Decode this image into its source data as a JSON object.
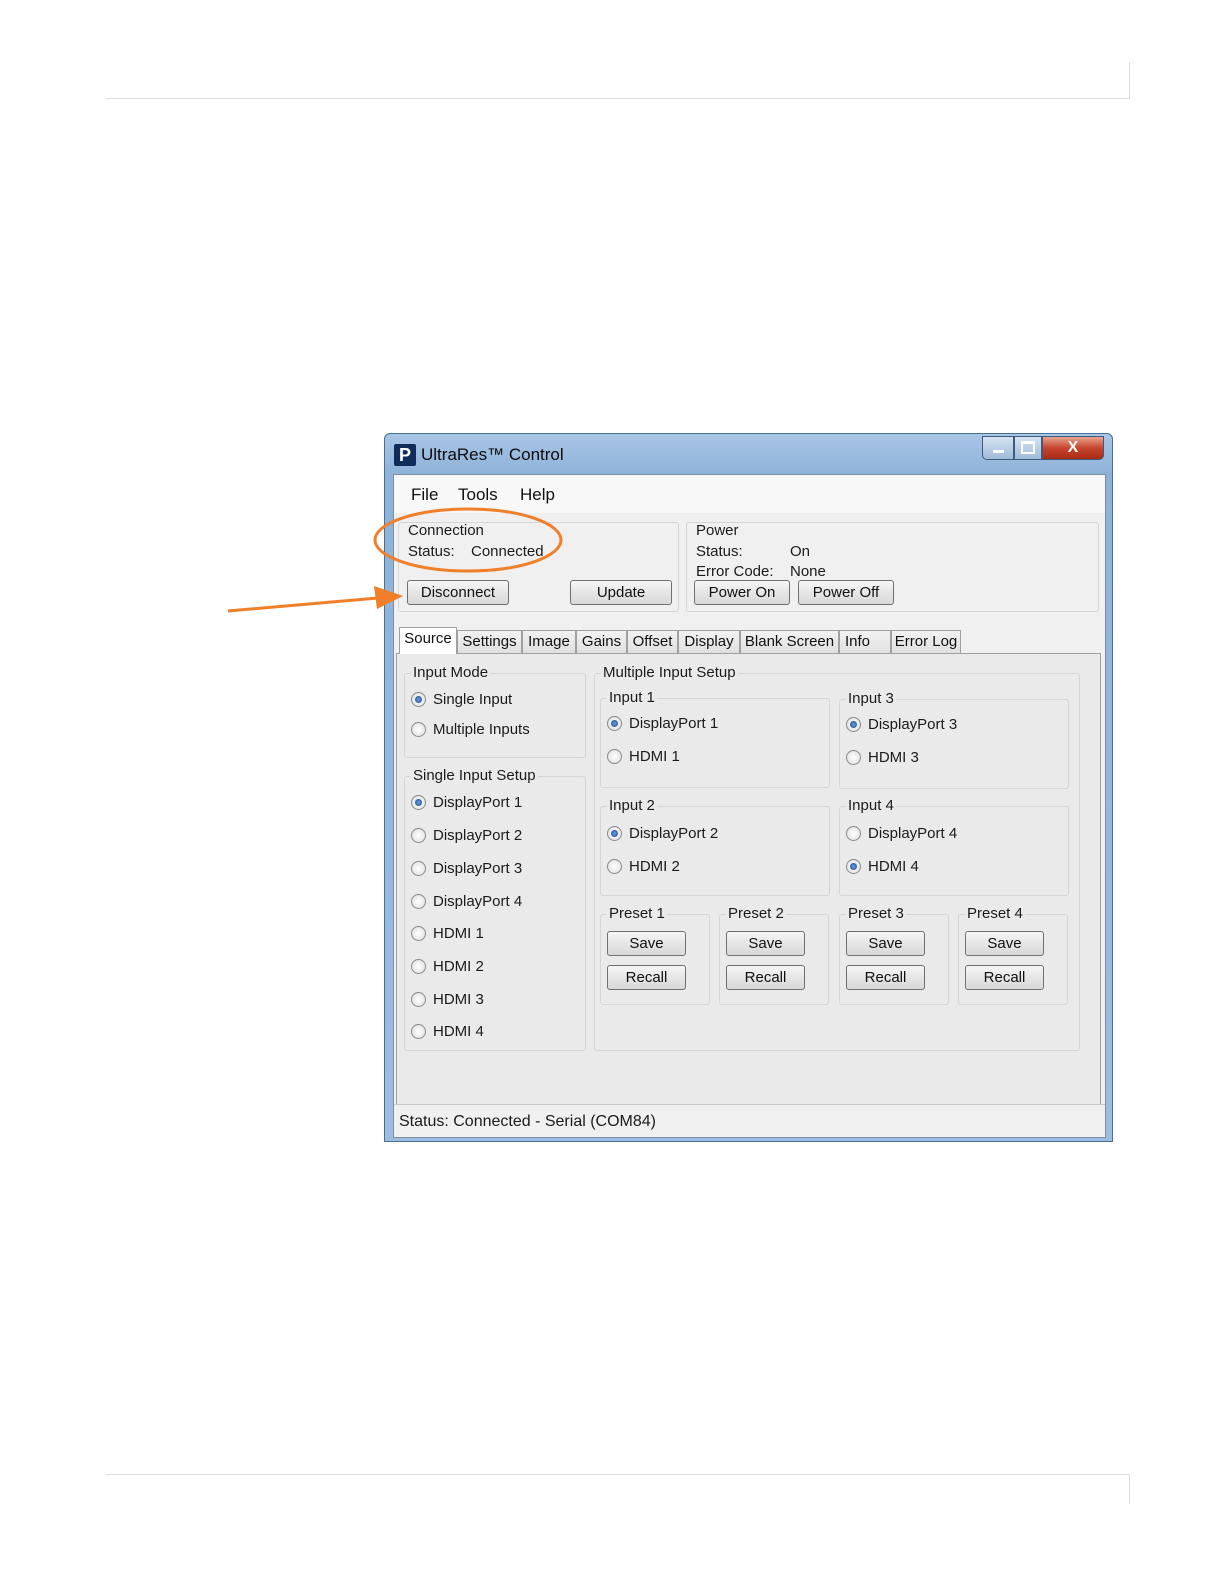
{
  "window": {
    "logo_letter": "P",
    "title": "UltraRes™ Control",
    "close_glyph": "X"
  },
  "menu": [
    "File",
    "Tools",
    "Help"
  ],
  "connection": {
    "group_label": "Connection",
    "status_label": "Status:",
    "status_value": "Connected",
    "disconnect_label": "Disconnect",
    "update_label": "Update"
  },
  "power": {
    "group_label": "Power",
    "status_label": "Status:",
    "status_value": "On",
    "error_label": "Error Code:",
    "error_value": "None",
    "power_on_label": "Power On",
    "power_off_label": "Power Off"
  },
  "tabs": [
    "Source",
    "Settings",
    "Image",
    "Gains",
    "Offset",
    "Display",
    "Blank Screen",
    "Info",
    "Error Log"
  ],
  "active_tab": "Source",
  "input_mode": {
    "label": "Input Mode",
    "options": [
      "Single Input",
      "Multiple Inputs"
    ],
    "selected": "Single Input"
  },
  "single_input_setup": {
    "label": "Single Input Setup",
    "options": [
      "DisplayPort 1",
      "DisplayPort 2",
      "DisplayPort 3",
      "DisplayPort 4",
      "HDMI 1",
      "HDMI 2",
      "HDMI 3",
      "HDMI 4"
    ],
    "selected": "DisplayPort 1"
  },
  "multiple_input_setup": {
    "label": "Multiple Input Setup",
    "inputs": [
      {
        "label": "Input 1",
        "options": [
          "DisplayPort 1",
          "HDMI 1"
        ],
        "selected": "DisplayPort 1"
      },
      {
        "label": "Input 3",
        "options": [
          "DisplayPort 3",
          "HDMI 3"
        ],
        "selected": "DisplayPort 3"
      },
      {
        "label": "Input 2",
        "options": [
          "DisplayPort 2",
          "HDMI 2"
        ],
        "selected": "DisplayPort 2"
      },
      {
        "label": "Input 4",
        "options": [
          "DisplayPort 4",
          "HDMI 4"
        ],
        "selected": "HDMI 4"
      }
    ],
    "presets": [
      {
        "label": "Preset 1",
        "save": "Save",
        "recall": "Recall"
      },
      {
        "label": "Preset 2",
        "save": "Save",
        "recall": "Recall"
      },
      {
        "label": "Preset 3",
        "save": "Save",
        "recall": "Recall"
      },
      {
        "label": "Preset 4",
        "save": "Save",
        "recall": "Recall"
      }
    ]
  },
  "statusbar": {
    "text": "Status:  Connected - Serial (COM84)"
  },
  "colors": {
    "callout": "#f07f2a",
    "titlebar": "#9dbde0",
    "close_button": "#c7452e"
  }
}
